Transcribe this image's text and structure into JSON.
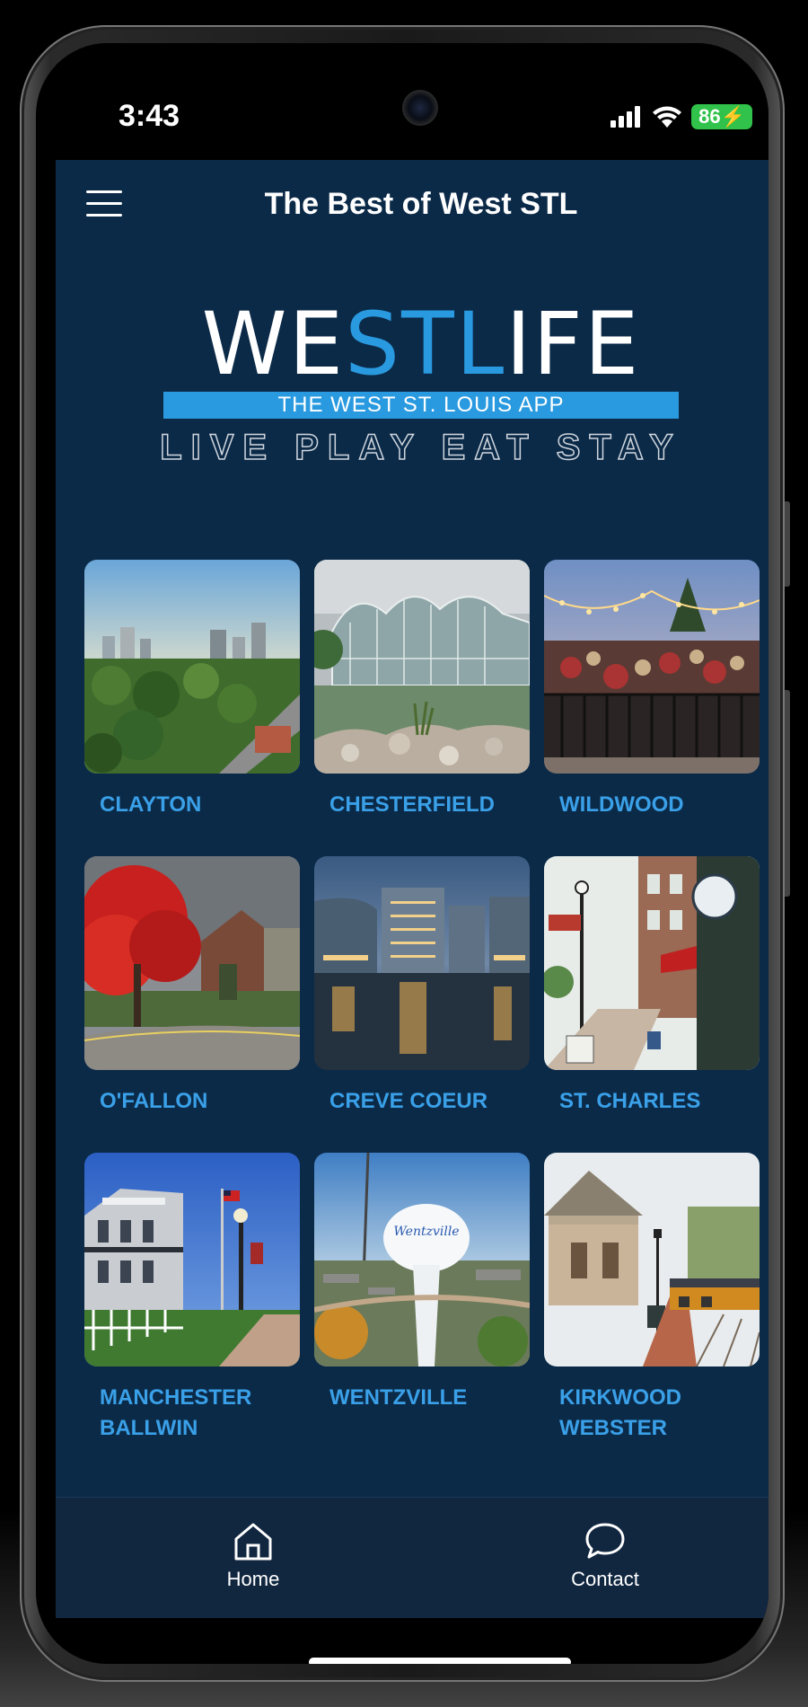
{
  "status_bar": {
    "time": "3:43",
    "battery": "86"
  },
  "header": {
    "title": "The Best of West STL"
  },
  "logo": {
    "word_part1": "WE",
    "word_part2": "STL",
    "word_part3": "IFE",
    "band": "THE WEST ST. LOUIS  APP",
    "tagline": "LIVE PLAY EAT STAY"
  },
  "cities": [
    {
      "label": "CLAYTON"
    },
    {
      "label": "CHESTERFIELD"
    },
    {
      "label": "WILDWOOD"
    },
    {
      "label": "O'FALLON"
    },
    {
      "label": "CREVE COEUR"
    },
    {
      "label": "ST. CHARLES"
    },
    {
      "label_line1": "MANCHESTER",
      "label_line2": "BALLWIN"
    },
    {
      "label": "WENTZVILLE"
    },
    {
      "label_line1": "KIRKWOOD",
      "label_line2": "WEBSTER"
    }
  ],
  "nav": {
    "home": "Home",
    "contact": "Contact"
  },
  "colors": {
    "background": "#0b2a48",
    "accent": "#2a9ae0",
    "label": "#3aa0e8",
    "nav_bg": "#112740"
  }
}
